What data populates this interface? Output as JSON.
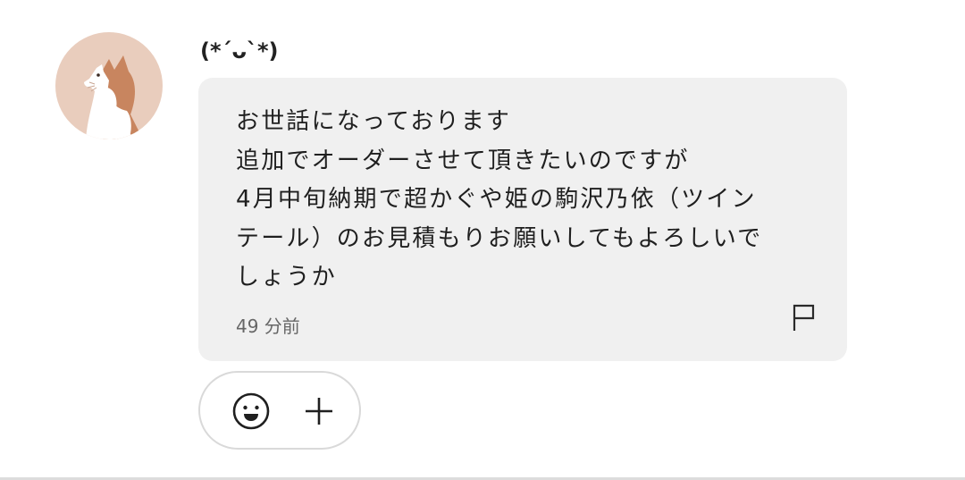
{
  "message": {
    "avatar_icon": "cat-avatar-icon",
    "username": "(*´ᴗ`*)",
    "lines": [
      "お世話になっております",
      "追加でオーダーさせて頂きたいのですが",
      "4月中旬納期で超かぐや姫の駒沢乃依（ツイン",
      "テール）のお見積もりお願いしてもよろしいで",
      "しょうか"
    ],
    "timestamp": "49 分前",
    "report_icon": "flag-icon"
  },
  "reactions": {
    "emoji_icon": "smiley-face-icon",
    "add_icon": "plus-icon"
  },
  "colors": {
    "bubble_background": "#f0f0f0",
    "text": "#1f1f1f",
    "timestamp": "#666666",
    "reaction_border": "#d9d9d9"
  }
}
